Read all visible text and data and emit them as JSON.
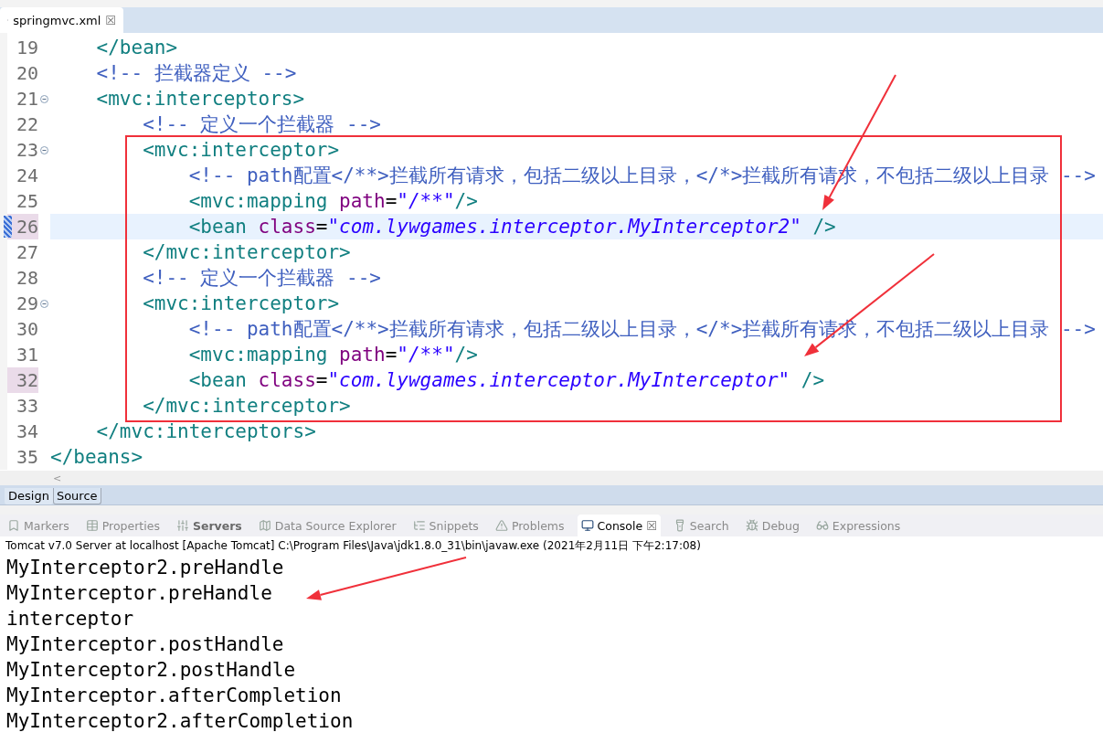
{
  "editor_tab": {
    "title": "springmvc.xml",
    "close": "☒"
  },
  "code_lines": [
    {
      "number": "19",
      "foldable": false,
      "marked": false,
      "current": false,
      "tokens": [
        {
          "kind": "tag",
          "text": "    </bean>"
        }
      ]
    },
    {
      "number": "20",
      "foldable": false,
      "marked": false,
      "current": false,
      "tokens": [
        {
          "kind": "comment",
          "text": "    <!-- 拦截器定义 -->"
        }
      ]
    },
    {
      "number": "21",
      "foldable": true,
      "marked": false,
      "current": false,
      "tokens": [
        {
          "kind": "tag",
          "text": "    <mvc:interceptors>"
        }
      ]
    },
    {
      "number": "22",
      "foldable": false,
      "marked": false,
      "current": false,
      "tokens": [
        {
          "kind": "comment",
          "text": "        <!-- 定义一个拦截器 -->"
        }
      ]
    },
    {
      "number": "23",
      "foldable": true,
      "marked": false,
      "current": false,
      "tokens": [
        {
          "kind": "tag",
          "text": "        <mvc:interceptor>"
        }
      ]
    },
    {
      "number": "24",
      "foldable": false,
      "marked": false,
      "current": false,
      "tokens": [
        {
          "kind": "comment",
          "text": "            <!-- path配置</**>拦截所有请求，包括二级以上目录，</*>拦截所有请求，不包括二级以上目录 -->"
        }
      ]
    },
    {
      "number": "25",
      "foldable": false,
      "marked": false,
      "current": false,
      "tokens": [
        {
          "kind": "tag",
          "text": "            <mvc:mapping "
        },
        {
          "kind": "attr",
          "text": "path"
        },
        {
          "kind": "punct",
          "text": "="
        },
        {
          "kind": "value",
          "text": "\"/**\""
        },
        {
          "kind": "tag",
          "text": "/>"
        }
      ]
    },
    {
      "number": "26",
      "foldable": false,
      "marked": true,
      "current": true,
      "tokens": [
        {
          "kind": "tag",
          "text": "            <bean "
        },
        {
          "kind": "attr",
          "text": "class"
        },
        {
          "kind": "punct",
          "text": "="
        },
        {
          "kind": "value",
          "text": "\"com.lywgames.interceptor.MyInterceptor2\""
        },
        {
          "kind": "tag",
          "text": " />"
        }
      ]
    },
    {
      "number": "27",
      "foldable": false,
      "marked": false,
      "current": false,
      "tokens": [
        {
          "kind": "tag",
          "text": "        </mvc:interceptor>"
        }
      ]
    },
    {
      "number": "28",
      "foldable": false,
      "marked": false,
      "current": false,
      "tokens": [
        {
          "kind": "comment",
          "text": "        <!-- 定义一个拦截器 -->"
        }
      ]
    },
    {
      "number": "29",
      "foldable": true,
      "marked": false,
      "current": false,
      "tokens": [
        {
          "kind": "tag",
          "text": "        <mvc:interceptor>"
        }
      ]
    },
    {
      "number": "30",
      "foldable": false,
      "marked": false,
      "current": false,
      "tokens": [
        {
          "kind": "comment",
          "text": "            <!-- path配置</**>拦截所有请求，包括二级以上目录，</*>拦截所有请求，不包括二级以上目录 -->"
        }
      ]
    },
    {
      "number": "31",
      "foldable": false,
      "marked": false,
      "current": false,
      "tokens": [
        {
          "kind": "tag",
          "text": "            <mvc:mapping "
        },
        {
          "kind": "attr",
          "text": "path"
        },
        {
          "kind": "punct",
          "text": "="
        },
        {
          "kind": "value",
          "text": "\"/**\""
        },
        {
          "kind": "tag",
          "text": "/>"
        }
      ]
    },
    {
      "number": "32",
      "foldable": false,
      "marked": true,
      "current": false,
      "tokens": [
        {
          "kind": "tag",
          "text": "            <bean "
        },
        {
          "kind": "attr",
          "text": "class"
        },
        {
          "kind": "punct",
          "text": "="
        },
        {
          "kind": "value",
          "text": "\"com.lywgames.interceptor.MyInterceptor\""
        },
        {
          "kind": "tag",
          "text": " />"
        }
      ]
    },
    {
      "number": "33",
      "foldable": false,
      "marked": false,
      "current": false,
      "tokens": [
        {
          "kind": "tag",
          "text": "        </mvc:interceptor>"
        }
      ]
    },
    {
      "number": "34",
      "foldable": false,
      "marked": false,
      "current": false,
      "tokens": [
        {
          "kind": "tag",
          "text": "    </mvc:interceptors>"
        }
      ]
    },
    {
      "number": "35",
      "foldable": false,
      "marked": false,
      "current": false,
      "tokens": [
        {
          "kind": "tag",
          "text": "</beans>"
        }
      ]
    }
  ],
  "scroll_arrow": "<",
  "editor_modes": [
    {
      "label": "Design",
      "selected": false
    },
    {
      "label": "Source",
      "selected": true
    }
  ],
  "view_tabs": [
    {
      "label": "Markers",
      "selected": false,
      "emphasized": false
    },
    {
      "label": "Properties",
      "selected": false,
      "emphasized": false
    },
    {
      "label": "Servers",
      "selected": false,
      "emphasized": true
    },
    {
      "label": "Data Source Explorer",
      "selected": false,
      "emphasized": false
    },
    {
      "label": "Snippets",
      "selected": false,
      "emphasized": false
    },
    {
      "label": "Problems",
      "selected": false,
      "emphasized": false
    },
    {
      "label": "Console",
      "selected": true,
      "emphasized": false
    },
    {
      "label": "Search",
      "selected": false,
      "emphasized": false
    },
    {
      "label": "Debug",
      "selected": false,
      "emphasized": false
    },
    {
      "label": "Expressions",
      "selected": false,
      "emphasized": false
    }
  ],
  "console": {
    "header": "Tomcat v7.0 Server at localhost [Apache Tomcat] C:\\Program Files\\Java\\jdk1.8.0_31\\bin\\javaw.exe (2021年2月11日 下午2:17:08)",
    "lines": [
      "MyInterceptor2.preHandle",
      "MyInterceptor.preHandle",
      "interceptor",
      "MyInterceptor.postHandle",
      "MyInterceptor2.postHandle",
      "MyInterceptor.afterCompletion",
      "MyInterceptor2.afterCompletion"
    ]
  }
}
